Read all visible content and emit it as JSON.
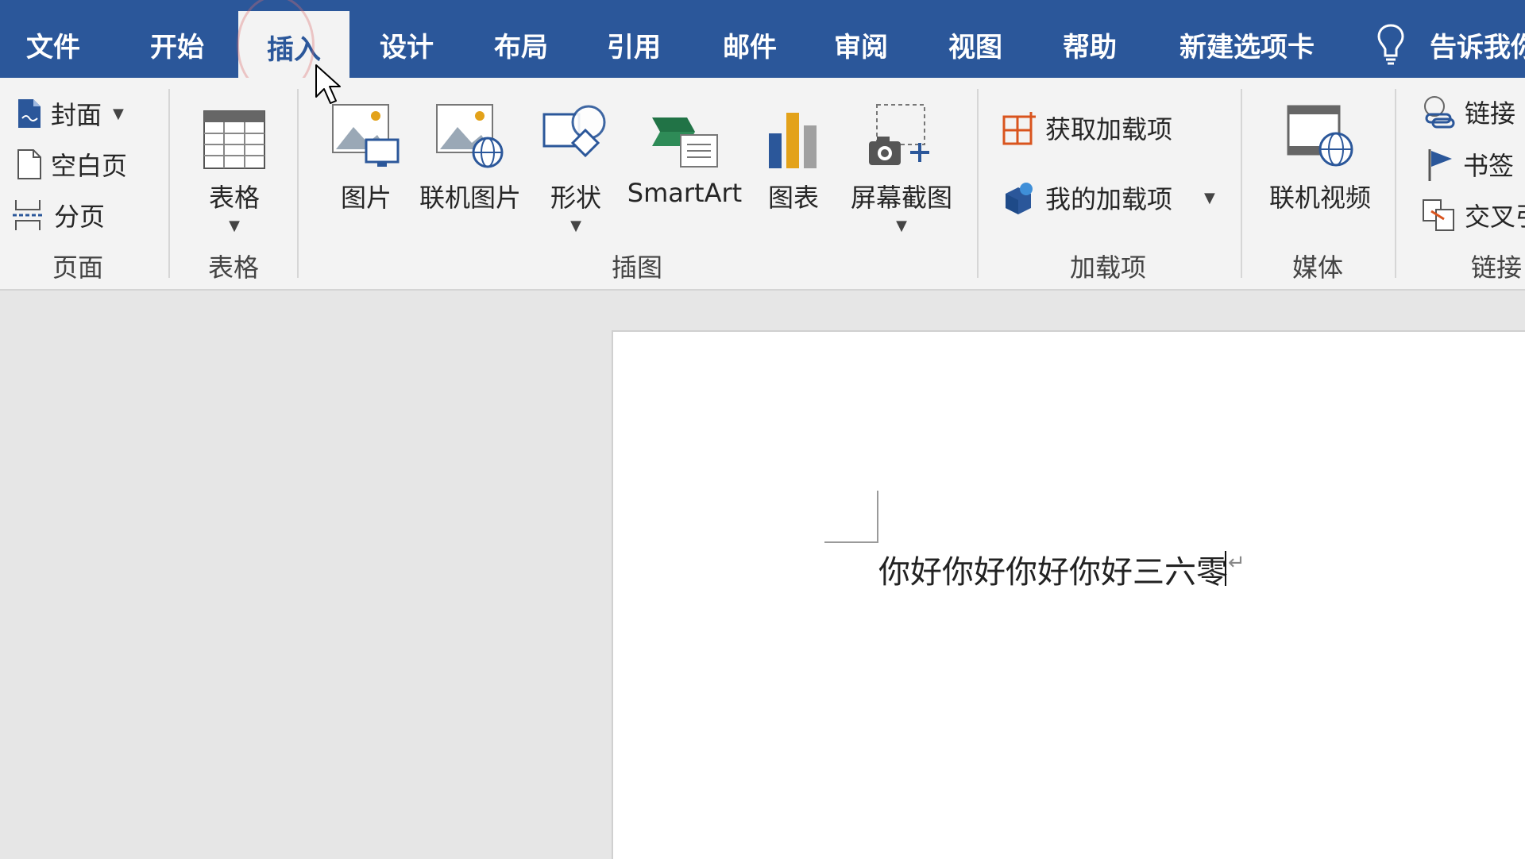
{
  "tabs": [
    {
      "label": "文件",
      "active": false
    },
    {
      "label": "开始",
      "active": false
    },
    {
      "label": "插入",
      "active": true
    },
    {
      "label": "设计",
      "active": false
    },
    {
      "label": "布局",
      "active": false
    },
    {
      "label": "引用",
      "active": false
    },
    {
      "label": "邮件",
      "active": false
    },
    {
      "label": "审阅",
      "active": false
    },
    {
      "label": "视图",
      "active": false
    },
    {
      "label": "帮助",
      "active": false
    },
    {
      "label": "新建选项卡",
      "active": false
    }
  ],
  "tell_me": "告诉我你",
  "groups": {
    "pages": {
      "label": "页面",
      "cover": "封面",
      "blank": "空白页",
      "break": "分页"
    },
    "tables": {
      "label": "表格",
      "table": "表格"
    },
    "illustrations": {
      "label": "插图",
      "picture": "图片",
      "online_picture": "联机图片",
      "shapes": "形状",
      "smartart": "SmartArt",
      "chart": "图表",
      "screenshot": "屏幕截图"
    },
    "addins": {
      "label": "加载项",
      "get": "获取加载项",
      "mine": "我的加载项"
    },
    "media": {
      "label": "媒体",
      "online_video": "联机视频"
    },
    "links": {
      "label": "链接",
      "link": "链接",
      "bookmark": "书签",
      "crossref": "交叉引"
    }
  },
  "document": {
    "text": "你好你好你好你好三六零"
  },
  "colors": {
    "tabbar": "#2b579a",
    "ribbon": "#f3f3f3",
    "workspace": "#e6e6e6",
    "page": "#ffffff",
    "accent_orange": "#d9541e",
    "accent_blue": "#2b579a"
  }
}
